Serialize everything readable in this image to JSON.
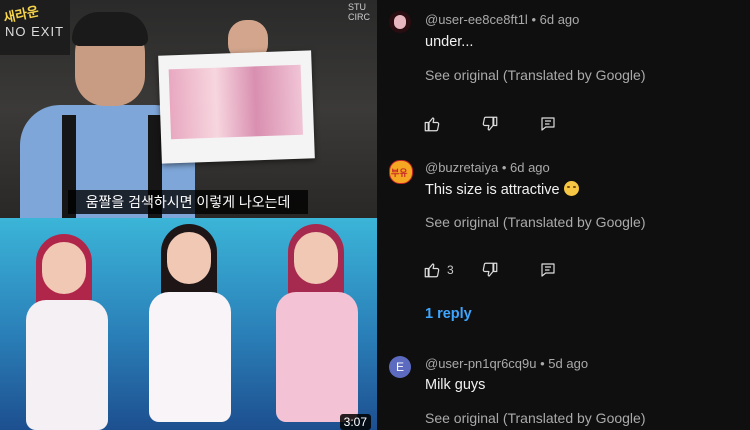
{
  "video": {
    "logo_line1": "새라운",
    "logo_line2": "NO EXIT",
    "studio_sign": "STU\nCIRC",
    "subtitle": "움짤을 검색하시면 이렇게 나오는데",
    "duration": "3:07"
  },
  "comments": [
    {
      "handle": "@user-ee8ce8ft1l",
      "age": "6d ago",
      "text": "under...",
      "see_original": "See original (Translated by Google)",
      "like_count": "",
      "avatar_color": "#6b1c24"
    },
    {
      "handle": "@buzretaiya",
      "age": "6d ago",
      "text": "This size is attractive",
      "emoji": "smiling-face-icon",
      "see_original": "See original (Translated by Google)",
      "like_count": "3",
      "reply_label": "1 reply",
      "avatar_color": "#f5a623",
      "avatar_text": "부유"
    },
    {
      "handle": "@user-pn1qr6cq9u",
      "age": "5d ago",
      "text": "Milk guys",
      "see_original": "See original (Translated by Google)",
      "avatar_letter": "E",
      "avatar_color": "#5c6bc0"
    }
  ],
  "separator": "•"
}
